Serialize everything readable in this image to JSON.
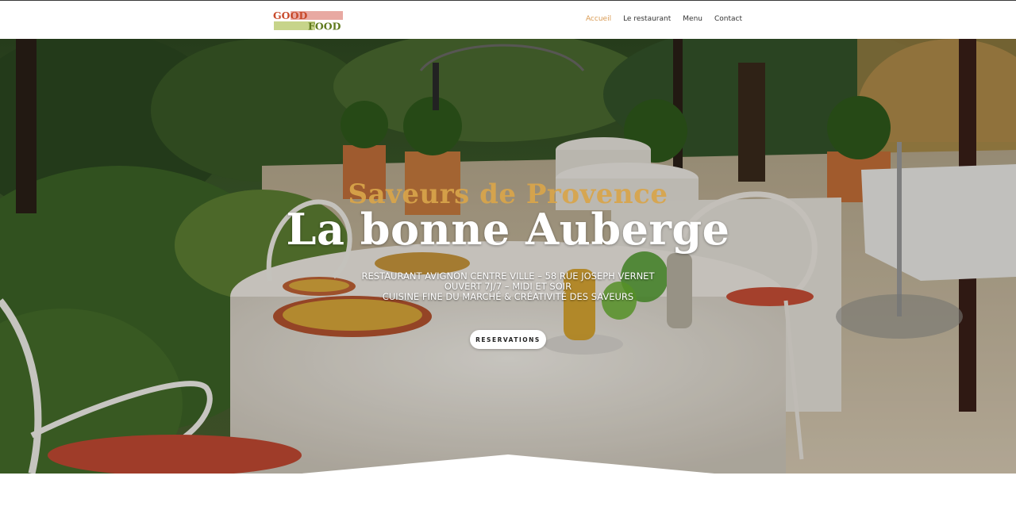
{
  "brand": {
    "logo_line1": "GOOD",
    "logo_line2": "FOOD",
    "colors": {
      "line1": "#c84a2b",
      "line2": "#5f7a1d",
      "band1": "#e8a9a2",
      "band2": "#c7d48a"
    }
  },
  "nav": {
    "items": [
      {
        "label": "Accueil",
        "active": true
      },
      {
        "label": "Le restaurant",
        "active": false
      },
      {
        "label": "Menu",
        "active": false
      },
      {
        "label": "Contact",
        "active": false
      }
    ],
    "active_color": "#d99a52"
  },
  "hero": {
    "kicker": "Saveurs de Provence",
    "title": "La bonne Auberge",
    "info_lines": [
      "RESTAURANT AVIGNON CENTRE VILLE – 58 RUE JOSEPH VERNET",
      "OUVERT 7J/7 – MIDI ET SOIR",
      "CUISINE FINE DU MARCHÉ & CRÉATIVITÉ DES SAVEURS"
    ],
    "button_label": "RESERVATIONS"
  }
}
